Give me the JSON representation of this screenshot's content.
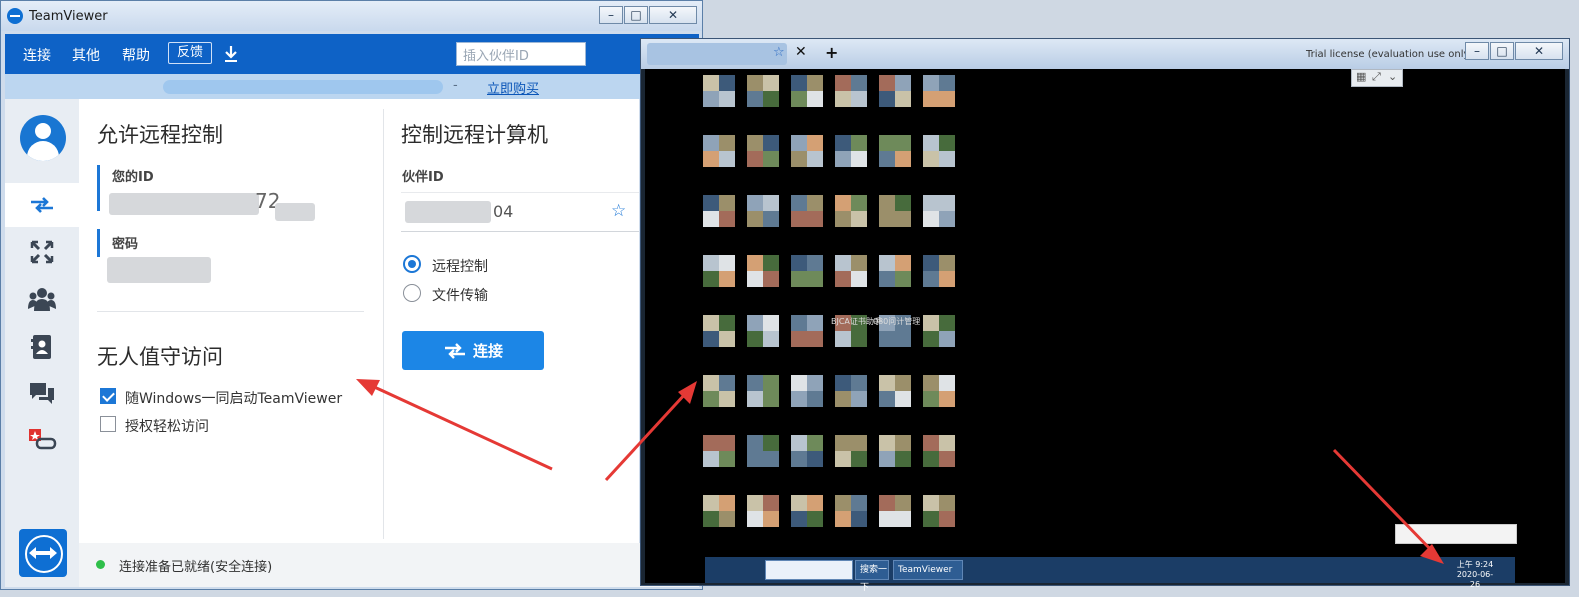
{
  "main_window": {
    "title": "TeamViewer",
    "menu": {
      "connect": "连接",
      "other": "其他",
      "help": "帮助",
      "feedback": "反馈"
    },
    "partner_input_placeholder": "插入伙伴ID",
    "license": {
      "dash": "-",
      "buy_link": "立即购买"
    },
    "allow_remote": {
      "heading": "允许远程控制",
      "your_id_label": "您的ID",
      "your_id_value_partial": "72",
      "password_label": "密码"
    },
    "unattended": {
      "heading": "无人值守访问",
      "options": [
        {
          "label": "随Windows一同启动TeamViewer",
          "checked": true
        },
        {
          "label": "授权轻松访问",
          "checked": false
        }
      ]
    },
    "control_remote": {
      "heading": "控制远程计算机",
      "partner_id_label": "伙伴ID",
      "partner_id_value_partial": "04",
      "modes": [
        {
          "label": "远程控制",
          "selected": true
        },
        {
          "label": "文件传输",
          "selected": false
        }
      ],
      "connect_button": "连接"
    },
    "status": {
      "text": "连接准备已就绪(安全连接)",
      "color": "#2fbf4a"
    },
    "sidebar_icons": [
      "avatar-icon",
      "remote-control-icon",
      "meeting-icon",
      "contacts-icon",
      "computers-contacts-icon",
      "chat-icon",
      "augmented-reality-icon",
      "teamviewer-logo-icon"
    ]
  },
  "remote_window": {
    "trial_text": "Trial license (evaluation use only)",
    "taskbar": {
      "search_button": "搜索一下",
      "teamviewer_button": "TeamViewer",
      "clock_time": "上午 9:24",
      "clock_date": "2020-06-26"
    },
    "desktop_labels": [
      "BJCA证书助手",
      "080问计管理"
    ]
  },
  "colors": {
    "accent": "#0e62c6",
    "connect_button": "#1c86e6",
    "annotation_arrow": "#e53935"
  }
}
